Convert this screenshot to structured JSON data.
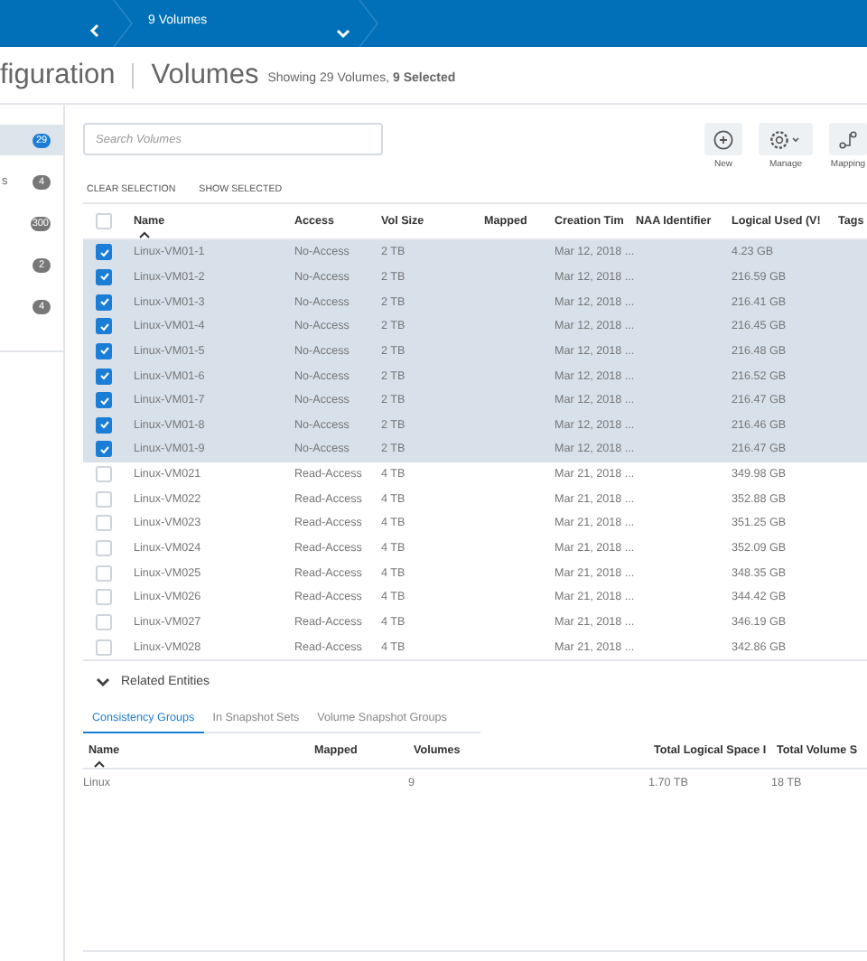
{
  "breadcrumb": {
    "label": "9 Volumes"
  },
  "header": {
    "title": "figuration",
    "section": "Volumes",
    "summary": "Showing 29 Volumes, **9 Selected**"
  },
  "sidebar": {
    "items": [
      {
        "count": "29",
        "selected": true
      },
      {
        "label": "s",
        "count": "4",
        "selected": false
      },
      {
        "count": "300",
        "selected": false
      },
      {
        "count": "2",
        "selected": false
      },
      {
        "count": "4",
        "selected": false
      }
    ]
  },
  "search": {
    "placeholder": "Search Volumes"
  },
  "links": [
    "CLEAR SELECTION",
    "SHOW SELECTED"
  ],
  "actions": [
    {
      "kind": "new",
      "label": "New"
    },
    {
      "kind": "manage",
      "label": "Manage"
    },
    {
      "kind": "mapping",
      "label": "Mapping"
    }
  ],
  "table": {
    "all_checked": false,
    "columns": [
      {
        "label": "Name",
        "sorted": true
      },
      {
        "label": "Access",
        "sorted": false
      },
      {
        "label": "Vol Size",
        "sorted": false
      },
      {
        "label": "Mapped",
        "sorted": false
      },
      {
        "label": "Creation Tim",
        "sorted": false
      },
      {
        "label": "NAA Identifier",
        "sorted": false
      },
      {
        "label": "Logical Used (V!",
        "sorted": false
      },
      {
        "label": "Tags",
        "sorted": false
      }
    ],
    "rows": [
      {
        "name": "Linux-VM01-1",
        "access": "No-Access",
        "vol_size": "2 TB",
        "creation_time": "Mar 12, 2018 ...",
        "logical_used": "4.23 GB",
        "selected": true
      },
      {
        "name": "Linux-VM01-2",
        "access": "No-Access",
        "vol_size": "2 TB",
        "creation_time": "Mar 12, 2018 ...",
        "logical_used": "216.59 GB",
        "selected": true
      },
      {
        "name": "Linux-VM01-3",
        "access": "No-Access",
        "vol_size": "2 TB",
        "creation_time": "Mar 12, 2018 ...",
        "logical_used": "216.41 GB",
        "selected": true
      },
      {
        "name": "Linux-VM01-4",
        "access": "No-Access",
        "vol_size": "2 TB",
        "creation_time": "Mar 12, 2018 ...",
        "logical_used": "216.45 GB",
        "selected": true
      },
      {
        "name": "Linux-VM01-5",
        "access": "No-Access",
        "vol_size": "2 TB",
        "creation_time": "Mar 12, 2018 ...",
        "logical_used": "216.48 GB",
        "selected": true
      },
      {
        "name": "Linux-VM01-6",
        "access": "No-Access",
        "vol_size": "2 TB",
        "creation_time": "Mar 12, 2018 ...",
        "logical_used": "216.52 GB",
        "selected": true
      },
      {
        "name": "Linux-VM01-7",
        "access": "No-Access",
        "vol_size": "2 TB",
        "creation_time": "Mar 12, 2018 ...",
        "logical_used": "216.47 GB",
        "selected": true
      },
      {
        "name": "Linux-VM01-8",
        "access": "No-Access",
        "vol_size": "2 TB",
        "creation_time": "Mar 12, 2018 ...",
        "logical_used": "216.46 GB",
        "selected": true
      },
      {
        "name": "Linux-VM01-9",
        "access": "No-Access",
        "vol_size": "2 TB",
        "creation_time": "Mar 12, 2018 ...",
        "logical_used": "216.47 GB",
        "selected": true
      },
      {
        "name": "Linux-VM021",
        "access": "Read-Access",
        "vol_size": "4 TB",
        "creation_time": "Mar 21, 2018 ...",
        "logical_used": "349.98 GB",
        "selected": false
      },
      {
        "name": "Linux-VM022",
        "access": "Read-Access",
        "vol_size": "4 TB",
        "creation_time": "Mar 21, 2018 ...",
        "logical_used": "352.88 GB",
        "selected": false
      },
      {
        "name": "Linux-VM023",
        "access": "Read-Access",
        "vol_size": "4 TB",
        "creation_time": "Mar 21, 2018 ...",
        "logical_used": "351.25 GB",
        "selected": false
      },
      {
        "name": "Linux-VM024",
        "access": "Read-Access",
        "vol_size": "4 TB",
        "creation_time": "Mar 21, 2018 ...",
        "logical_used": "352.09 GB",
        "selected": false
      },
      {
        "name": "Linux-VM025",
        "access": "Read-Access",
        "vol_size": "4 TB",
        "creation_time": "Mar 21, 2018 ...",
        "logical_used": "348.35 GB",
        "selected": false
      },
      {
        "name": "Linux-VM026",
        "access": "Read-Access",
        "vol_size": "4 TB",
        "creation_time": "Mar 21, 2018 ...",
        "logical_used": "344.42 GB",
        "selected": false
      },
      {
        "name": "Linux-VM027",
        "access": "Read-Access",
        "vol_size": "4 TB",
        "creation_time": "Mar 21, 2018 ...",
        "logical_used": "346.19 GB",
        "selected": false
      },
      {
        "name": "Linux-VM028",
        "access": "Read-Access",
        "vol_size": "4 TB",
        "creation_time": "Mar 21, 2018 ...",
        "logical_used": "342.86 GB",
        "selected": false
      }
    ]
  },
  "related": {
    "label": "Related Entities",
    "expanded": true,
    "tabs": [
      {
        "label": "Consistency Groups",
        "selected": true
      },
      {
        "label": "In Snapshot Sets",
        "selected": false
      },
      {
        "label": "Volume Snapshot Groups",
        "selected": false
      }
    ],
    "columns": [
      {
        "label": "Name",
        "sorted": true
      },
      {
        "label": "Mapped",
        "sorted": false
      },
      {
        "label": "Volumes",
        "sorted": false
      },
      {
        "label": "Total Logical Space I",
        "sorted": false
      },
      {
        "label": "Total Volume S",
        "sorted": false
      }
    ],
    "rows": [
      {
        "name": "Linux",
        "volumes": "9",
        "total_logical_space": "1.70 TB",
        "total_volume_size": "18 TB"
      }
    ]
  }
}
